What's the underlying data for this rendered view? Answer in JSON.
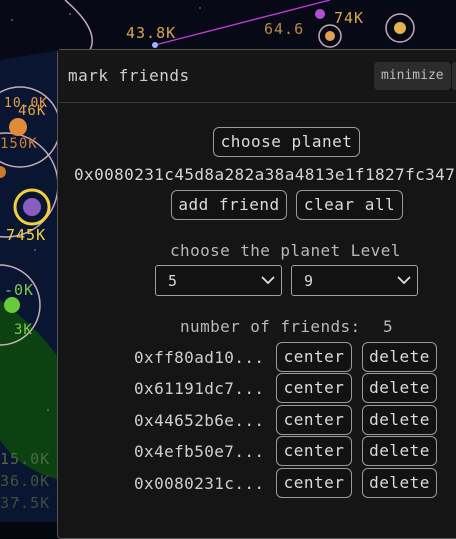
{
  "background": {
    "labels": [
      "43.8K",
      "10.0K",
      "46K",
      "150K",
      "745K",
      "-0K",
      "3K",
      "15.0K",
      "36.0K",
      "37.5K",
      "64.6",
      "74K"
    ]
  },
  "panel": {
    "title": "mark friends",
    "minimize_label": "minimize",
    "choose_planet_label": "choose planet",
    "selected_address": "0x0080231c45d8a282a38a4813e1f1827fc347",
    "add_friend_label": "add friend",
    "clear_all_label": "clear all",
    "level_heading": "choose the planet Level",
    "level_min": "5",
    "level_max": "9",
    "friends_count_label": "number of friends:",
    "friends_count": "5",
    "center_label": "center",
    "delete_label": "delete",
    "friends": [
      {
        "address": "0xff80ad10..."
      },
      {
        "address": "0x61191dc7..."
      },
      {
        "address": "0x44652b6e..."
      },
      {
        "address": "0x4efb50e7..."
      },
      {
        "address": "0x0080231c..."
      }
    ]
  }
}
